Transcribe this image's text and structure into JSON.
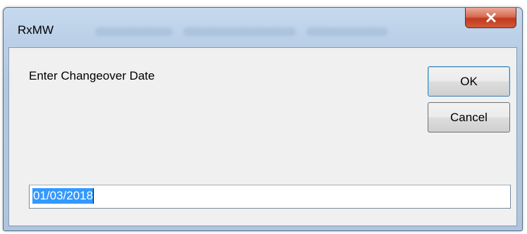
{
  "window": {
    "title": "RxMW",
    "close_label": "x"
  },
  "dialog": {
    "prompt": "Enter Changeover Date",
    "ok_label": "OK",
    "cancel_label": "Cancel",
    "date_value": "01/03/2018"
  },
  "colors": {
    "selection": "#3399ff",
    "close_button": "#c2391e",
    "frame": "#bcd1e8"
  }
}
